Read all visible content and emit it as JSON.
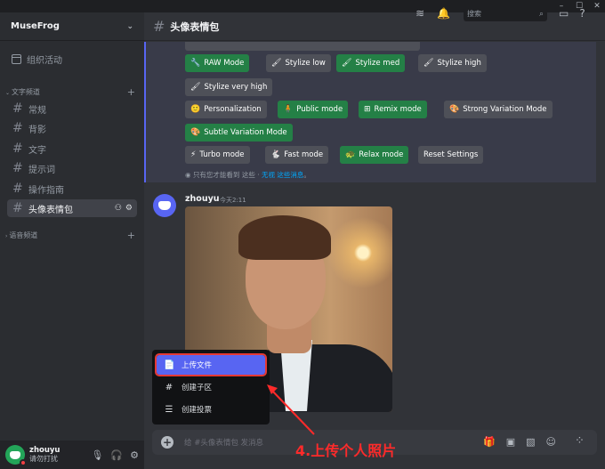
{
  "window": {
    "minimize": "–",
    "maximize": "☐",
    "close": "✕"
  },
  "server": {
    "name": "MuseFrog",
    "chevron": "⌄"
  },
  "sidebar": {
    "event_label": "组织活动",
    "text_category": "文字频道",
    "voice_category": "语音频道",
    "channels": [
      {
        "label": "常规"
      },
      {
        "label": "背影"
      },
      {
        "label": "文字"
      },
      {
        "label": "提示词"
      },
      {
        "label": "操作指南"
      },
      {
        "label": "头像表情包",
        "active": true
      }
    ]
  },
  "user": {
    "name": "zhouyu",
    "status": "请勿打扰"
  },
  "header": {
    "channel": "头像表情包",
    "search_placeholder": "搜索"
  },
  "buttons": {
    "raw": "RAW Mode",
    "stylize_low": "Stylize low",
    "stylize_med": "Stylize med",
    "stylize_high": "Stylize high",
    "stylize_very_high": "Stylize very high",
    "personalization": "Personalization",
    "public": "Public mode",
    "remix": "Remix mode",
    "strong_variation": "Strong Variation Mode",
    "subtle_variation": "Subtle Variation Mode",
    "turbo": "Turbo mode",
    "fast": "Fast mode",
    "relax": "Relax mode",
    "reset": "Reset Settings"
  },
  "ephemeral": {
    "prefix": "只有您才能看到 这些 · ",
    "link": "无视 这些消息",
    "suffix": "。"
  },
  "message": {
    "author": "zhouyu",
    "time": "今天2:11"
  },
  "popup": {
    "upload": "上传文件",
    "create_thread": "创建子区",
    "create_poll": "创建投票"
  },
  "composer": {
    "placeholder": "给 #头像表情包 发消息"
  },
  "annotation": {
    "text": "4.上传个人照片",
    "color": "#ff2a2a"
  },
  "colors": {
    "accent": "#5865f2",
    "green_button": "#248046",
    "gray_button": "#4e5058"
  }
}
